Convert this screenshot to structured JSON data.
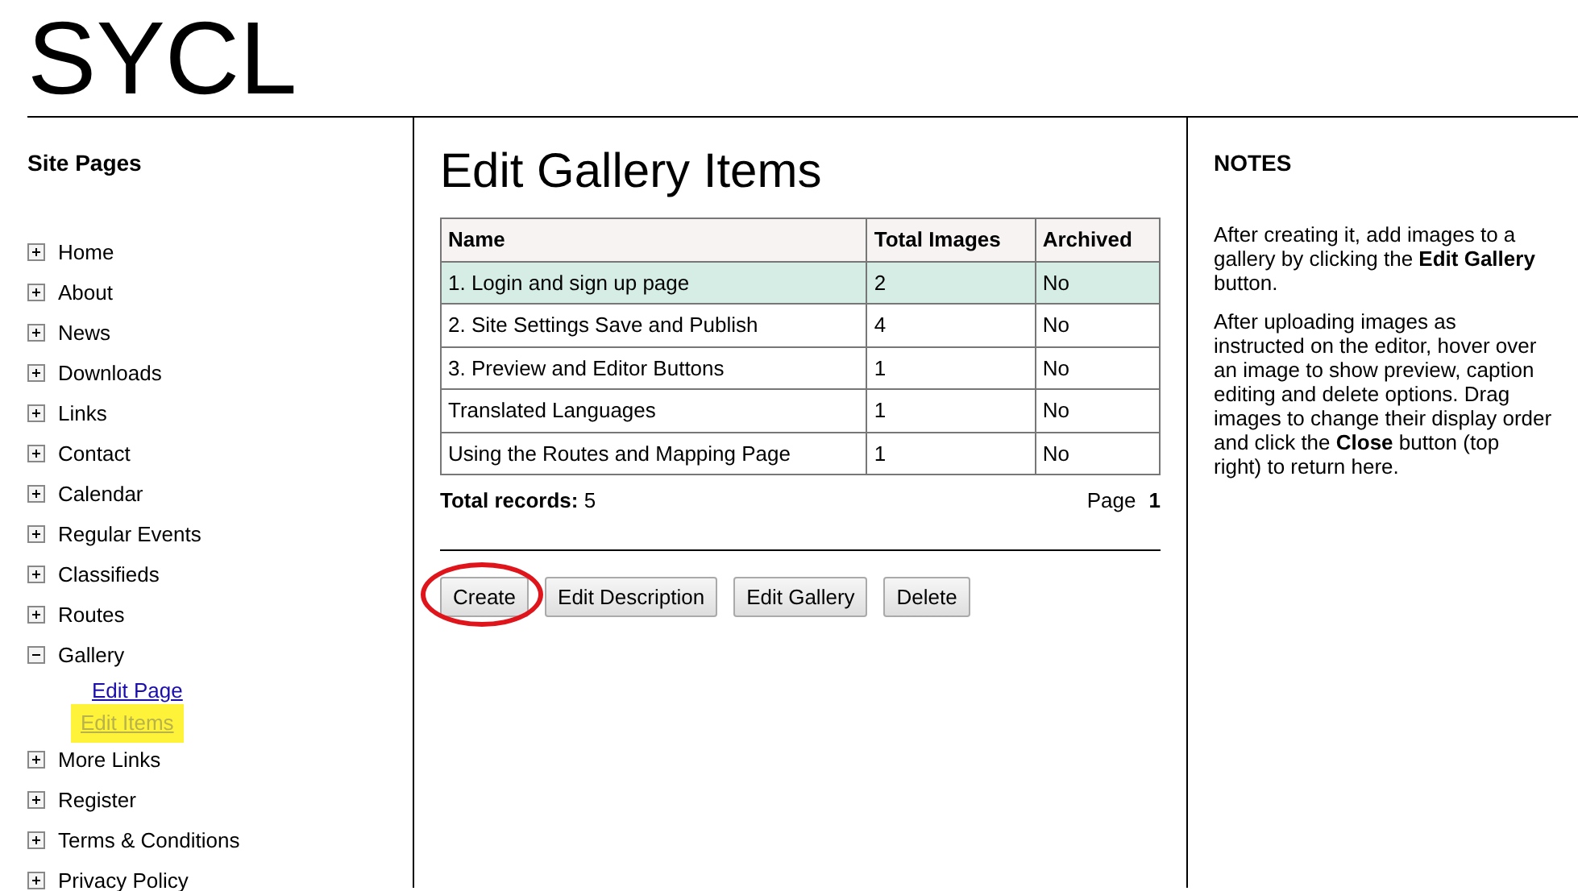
{
  "site_title": "SYCL",
  "sidebar": {
    "title": "Site Pages",
    "items": [
      {
        "label": "Home",
        "expanded": false
      },
      {
        "label": "About",
        "expanded": false
      },
      {
        "label": "News",
        "expanded": false
      },
      {
        "label": "Downloads",
        "expanded": false
      },
      {
        "label": "Links",
        "expanded": false
      },
      {
        "label": "Contact",
        "expanded": false
      },
      {
        "label": "Calendar",
        "expanded": false
      },
      {
        "label": "Regular Events",
        "expanded": false
      },
      {
        "label": "Classifieds",
        "expanded": false
      },
      {
        "label": "Routes",
        "expanded": false
      },
      {
        "label": "Gallery",
        "expanded": true,
        "children": [
          {
            "label": "Edit Page",
            "highlighted": false
          },
          {
            "label": "Edit Items",
            "highlighted": true
          }
        ]
      },
      {
        "label": "More Links",
        "expanded": false
      },
      {
        "label": "Register",
        "expanded": false
      },
      {
        "label": "Terms & Conditions",
        "expanded": false
      },
      {
        "label": "Privacy Policy",
        "expanded": false
      }
    ]
  },
  "main": {
    "heading": "Edit Gallery Items",
    "table": {
      "columns": [
        "Name",
        "Total Images",
        "Archived"
      ],
      "rows": [
        {
          "cells": [
            "1. Login and sign up page",
            "2",
            "No"
          ],
          "selected": true
        },
        {
          "cells": [
            "2. Site Settings Save and Publish",
            "4",
            "No"
          ],
          "selected": false
        },
        {
          "cells": [
            "3. Preview and Editor Buttons",
            "1",
            "No"
          ],
          "selected": false
        },
        {
          "cells": [
            "Translated Languages",
            "1",
            "No"
          ],
          "selected": false
        },
        {
          "cells": [
            "Using the Routes and Mapping Page",
            "1",
            "No"
          ],
          "selected": false
        }
      ]
    },
    "total_records_label": "Total records:",
    "total_records": "5",
    "page_label": "Page",
    "page": "1",
    "buttons": [
      {
        "label": "Create",
        "circled": true
      },
      {
        "label": "Edit Description",
        "circled": false
      },
      {
        "label": "Edit Gallery",
        "circled": false
      },
      {
        "label": "Delete",
        "circled": false
      }
    ]
  },
  "notes": {
    "title": "NOTES",
    "paragraphs": [
      "After creating it, add images to a gallery by clicking the **Edit Gallery** button.",
      "After uploading images as instructed on the editor, hover over an image to show preview, caption editing and delete options. Drag images to change their display order and click the **Close** button (top right) to return here."
    ]
  }
}
